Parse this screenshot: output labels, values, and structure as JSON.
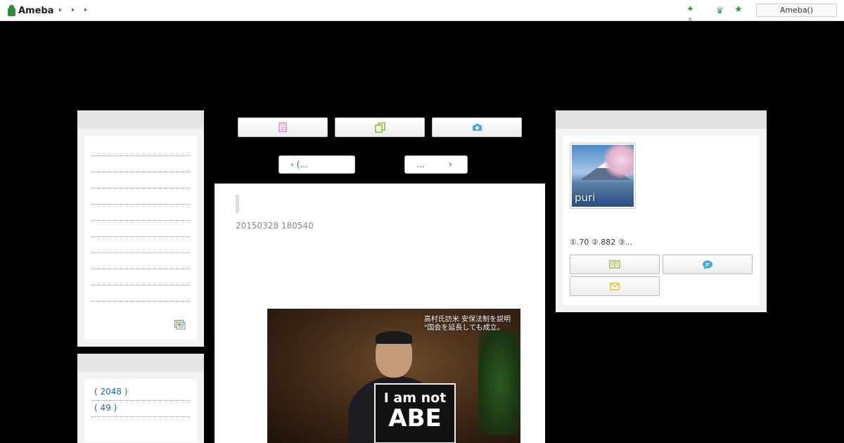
{
  "header": {
    "logo_text": "Ameba",
    "nav_arrows": [
      "arrow-1",
      "arrow-2",
      "arrow-3"
    ],
    "notification_count": "0",
    "ameba_button": "Ameba()",
    "accent_color": "#2f9e3a"
  },
  "center": {
    "tabs": [
      {
        "icon": "notebook-icon",
        "color": "#e07cc0"
      },
      {
        "icon": "copy-pages-icon",
        "color": "#6cbb1e"
      },
      {
        "icon": "camera-icon",
        "color": "#49a7d8"
      }
    ],
    "pager": {
      "prev_label": "‹ (...",
      "next_label": "...",
      "next_arrow": "›"
    },
    "article": {
      "date": "20150328 180540",
      "photo_caption_line1": "高村氏訪米 安保法制を説明",
      "photo_caption_line2": "\"国会を延長しても成立。",
      "photo_sign_line1": "I am not",
      "photo_sign_line2": "ABE"
    }
  },
  "left": {
    "category_links": [
      "( 2048 )",
      "( 49 )"
    ]
  },
  "right": {
    "profile_name": "puri",
    "stats": "①.70 ②.882 ③...",
    "buttons": [
      {
        "icon": "reader-icon",
        "color": "#8ab92e"
      },
      {
        "icon": "message-bubble-icon",
        "color": "#49a7d8"
      },
      {
        "icon": "mail-icon",
        "color": "#e0c01e"
      }
    ]
  }
}
